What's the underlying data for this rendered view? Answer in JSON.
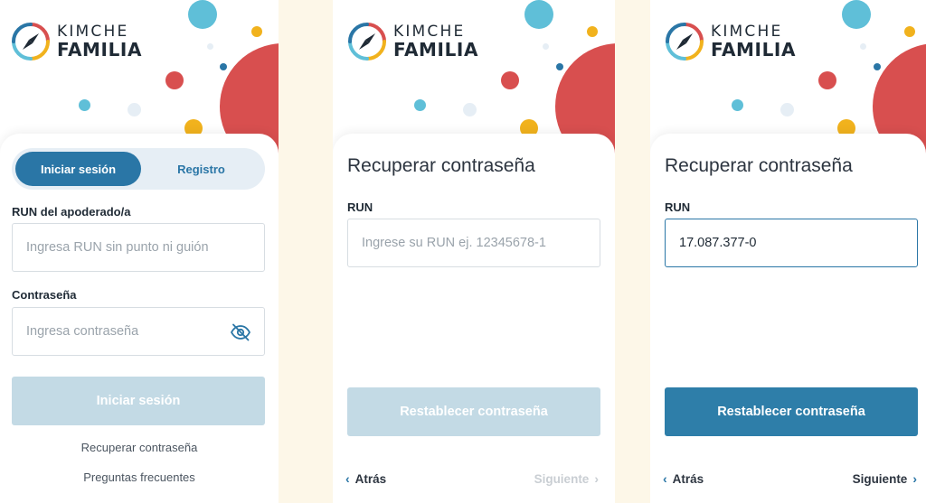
{
  "brand": {
    "top": "KIMCHE",
    "bottom": "FAMILIA"
  },
  "colors": {
    "primary": "#2a76a6",
    "button_disabled": "#c3dae5",
    "button_enabled": "#2e7ea9",
    "red": "#d84f4f",
    "teal": "#5fbfd8",
    "yellow": "#f1b21d",
    "background": "#fdf7e8"
  },
  "login": {
    "tab_login": "Iniciar sesión",
    "tab_register": "Registro",
    "run_label": "RUN del apoderado/a",
    "run_placeholder": "Ingresa RUN sin punto ni guión",
    "password_label": "Contraseña",
    "password_placeholder": "Ingresa contraseña",
    "submit": "Iniciar sesión",
    "recover_link": "Recuperar contraseña",
    "faq_link": "Preguntas frecuentes"
  },
  "recover_empty": {
    "title": "Recuperar contraseña",
    "run_label": "RUN",
    "run_placeholder": "Ingrese su RUN ej. 12345678-1",
    "submit": "Restablecer contraseña",
    "back": "Atrás",
    "next": "Siguiente"
  },
  "recover_filled": {
    "title": "Recuperar contraseña",
    "run_label": "RUN",
    "run_value": "17.087.377-0",
    "submit": "Restablecer contraseña",
    "back": "Atrás",
    "next": "Siguiente"
  }
}
